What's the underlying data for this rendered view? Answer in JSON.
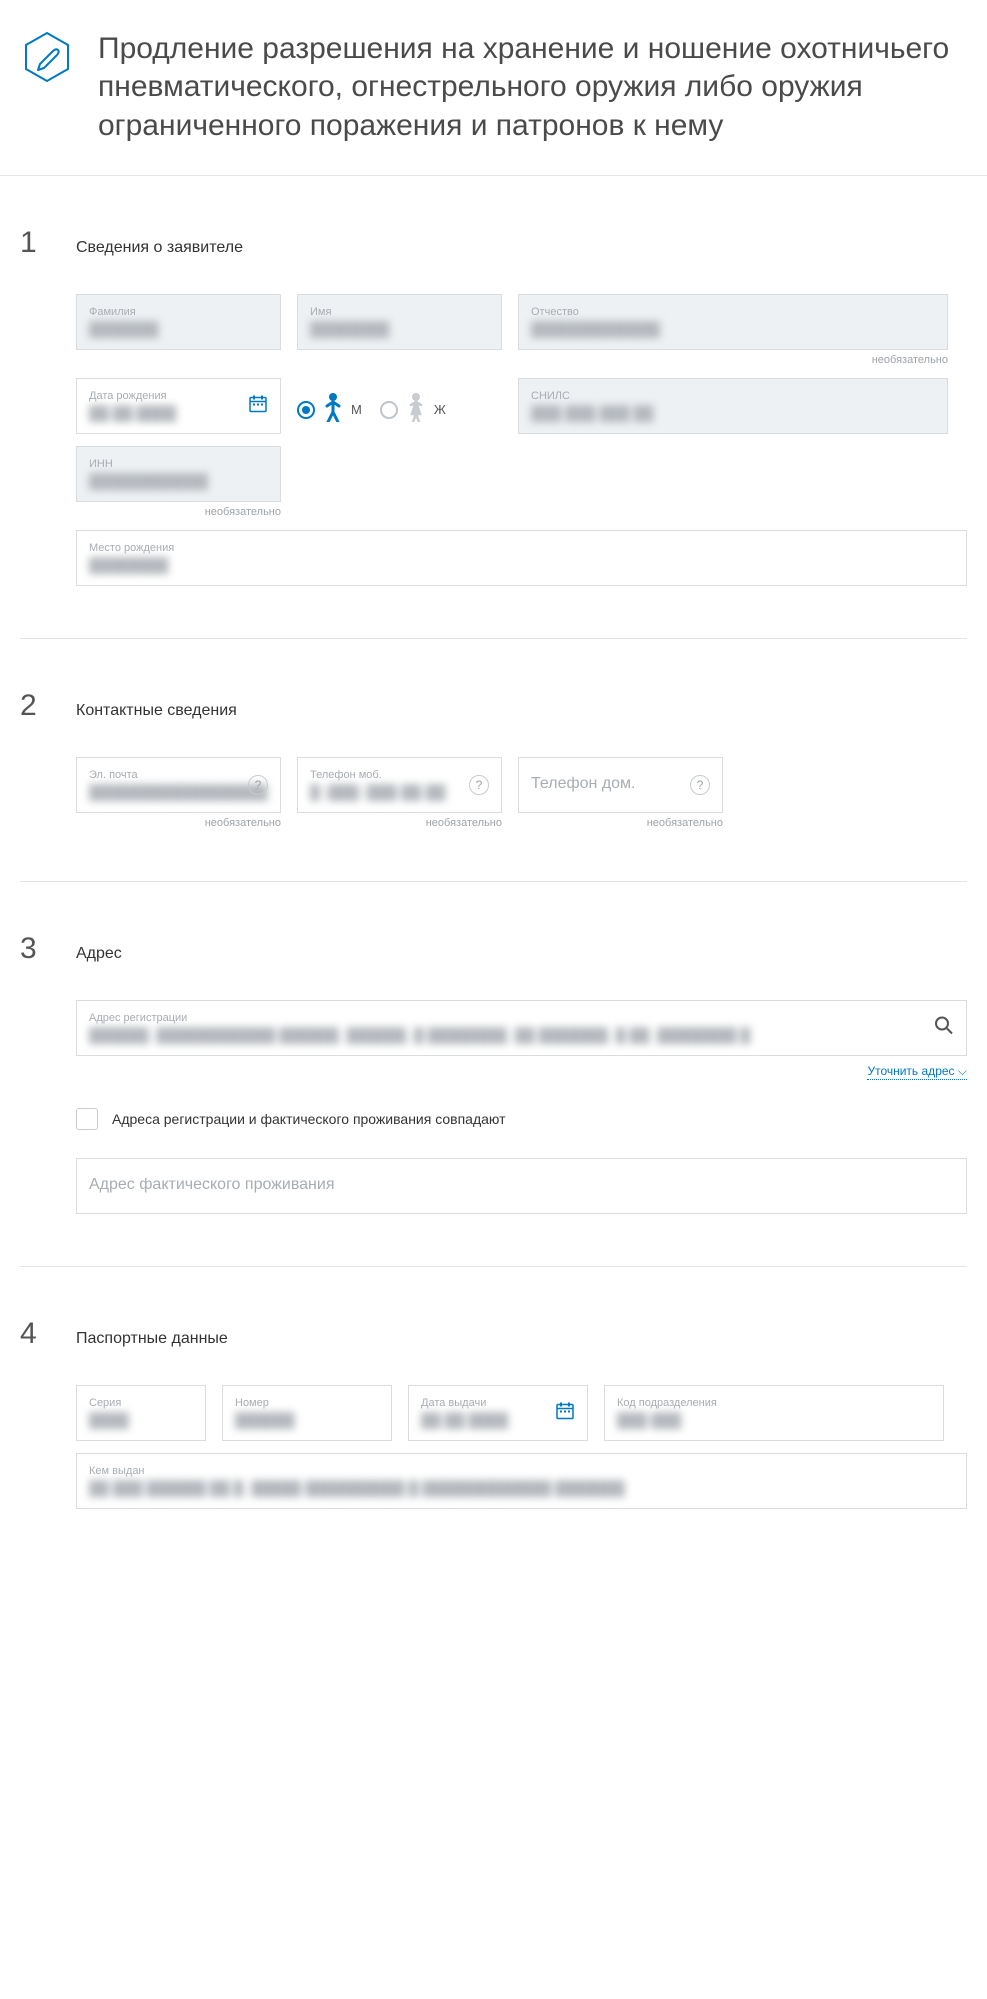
{
  "header": {
    "title": "Продление разрешения на хранение и ношение охотничьего пневматического, огнестрельного оружия либо оружия ограниченного поражения и патронов к нему"
  },
  "hints": {
    "optional": "необязательно"
  },
  "section1": {
    "num": "1",
    "title": "Сведения о заявителе",
    "surname_label": "Фамилия",
    "surname_value": "███████",
    "name_label": "Имя",
    "name_value": "████████",
    "patronymic_label": "Отчество",
    "patronymic_value": "█████████████",
    "dob_label": "Дата рождения",
    "dob_value": "██.██.████",
    "gender_m": "М",
    "gender_f": "Ж",
    "snils_label": "СНИЛС",
    "snils_value": "███-███-███ ██",
    "inn_label": "ИНН",
    "inn_value": "████████████",
    "birthplace_label": "Место рождения",
    "birthplace_value": "████████"
  },
  "section2": {
    "num": "2",
    "title": "Контактные сведения",
    "email_label": "Эл. почта",
    "email_value": "██████████████████",
    "mobile_label": "Телефон моб.",
    "mobile_value": "█ (███) ███-██-██",
    "home_placeholder": "Телефон дом."
  },
  "section3": {
    "num": "3",
    "title": "Адрес",
    "reg_label": "Адрес регистрации",
    "reg_value": "██████, ████████████ ██████, ██████, █ ████████, ██ ███████, █ ██, ████████ █",
    "refine": "Уточнить адрес",
    "same_label": "Адреса регистрации и фактического проживания совпадают",
    "actual_placeholder": "Адрес фактического проживания"
  },
  "section4": {
    "num": "4",
    "title": "Паспортные данные",
    "series_label": "Серия",
    "series_value": "████",
    "number_label": "Номер",
    "number_value": "██████",
    "issue_date_label": "Дата выдачи",
    "issue_date_value": "██.██.████",
    "dept_code_label": "Код подразделения",
    "dept_code_value": "███-███",
    "issued_by_label": "Кем выдан",
    "issued_by_value": "██ ███ ██████ ██ █. █████-██████████ █ █████████████ ███████"
  }
}
